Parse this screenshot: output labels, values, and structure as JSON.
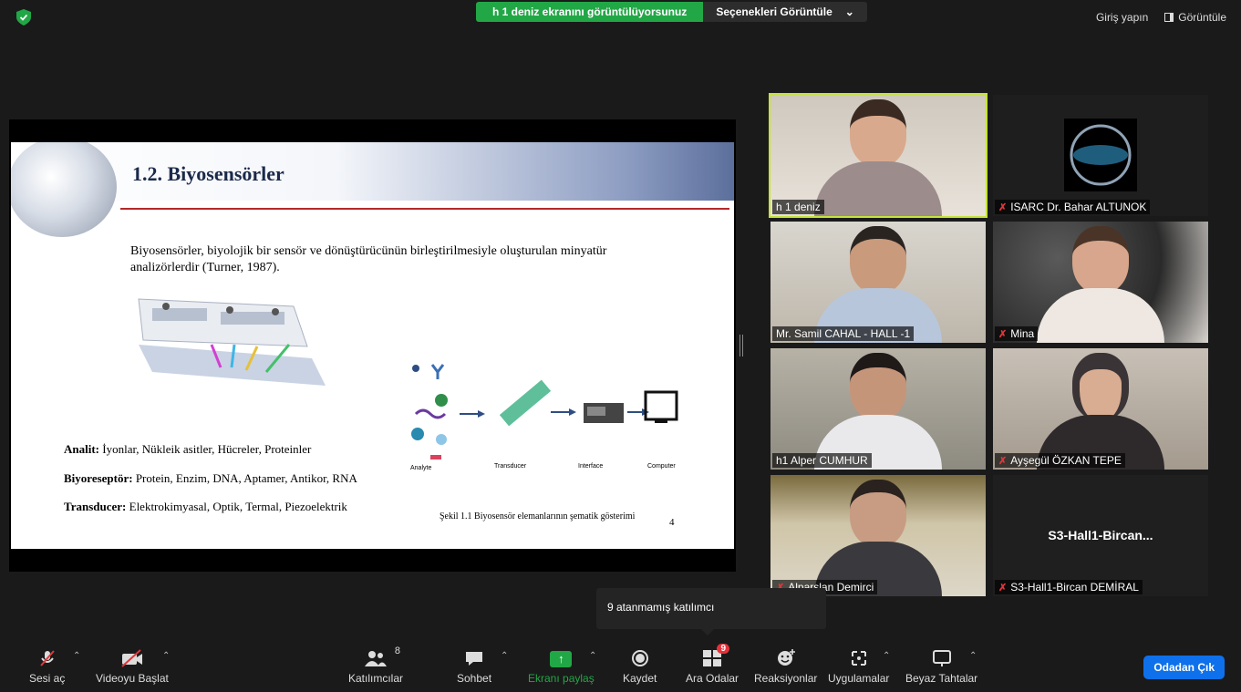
{
  "top_bar": {
    "share_banner": "h 1 deniz ekranını görüntülüyorsunuz",
    "options_label": "Seçenekleri Görüntüle",
    "sign_in": "Giriş yapın",
    "view": "Görüntüle"
  },
  "slide": {
    "title": "1.2. Biyosensörler",
    "intro": "Biyosensörler, biyolojik bir sensör ve dönüştürücünün birleştirilmesiyle oluşturulan minyatür analizörlerdir (Turner, 1987).",
    "analit_label": "Analit:",
    "analit_text": " İyonlar, Nükleik asitler, Hücreler, Proteinler",
    "bioreceptor_label": "Biyoreseptör:",
    "bioreceptor_text": " Protein, Enzim, DNA, Aptamer, Antikor, RNA",
    "transducer_label": "Transducer:",
    "transducer_text": " Elektrokimyasal, Optik, Termal, Piezoelektrik",
    "caption": "Şekil 1.1 Biyosensör elemanlarının şematik gösterimi",
    "page_number": "4",
    "schema_labels": [
      "Analyte",
      "Transducer",
      "Interface",
      "Computer"
    ]
  },
  "participants": [
    {
      "name": "h 1 deniz",
      "muted": false,
      "active": true
    },
    {
      "name": "ISARC Dr. Bahar ALTUNOK",
      "muted": true,
      "active": false
    },
    {
      "name": "Mr. Samil CAHAL - HALL -1",
      "muted": false,
      "active": false
    },
    {
      "name": "Mina",
      "muted": true,
      "active": false
    },
    {
      "name": "h1 Alper CUMHUR",
      "muted": false,
      "active": false
    },
    {
      "name": "Ayşegül ÖZKAN TEPE",
      "muted": true,
      "active": false
    },
    {
      "name": "Alparslan Demirci",
      "muted": true,
      "active": false
    },
    {
      "name": "S3-Hall1-Bircan DEMİRAL",
      "muted": true,
      "active": false,
      "display": "S3-Hall1-Bircan..."
    }
  ],
  "tooltip": "9 atanmamış katılımcı",
  "toolbar": {
    "unmute": "Sesi aç",
    "start_video": "Videoyu Başlat",
    "participants": "Katılımcılar",
    "participants_count": "8",
    "chat": "Sohbet",
    "share_screen": "Ekranı paylaş",
    "record": "Kaydet",
    "breakout": "Ara Odalar",
    "breakout_badge": "9",
    "reactions": "Reaksiyonlar",
    "apps": "Uygulamalar",
    "whiteboard": "Beyaz Tahtalar",
    "leave": "Odadan Çık"
  },
  "colors": {
    "share_green": "#22a746",
    "active_speaker": "#c5e33a",
    "leave_blue": "#0e71eb",
    "mute_red": "#e0373b"
  }
}
